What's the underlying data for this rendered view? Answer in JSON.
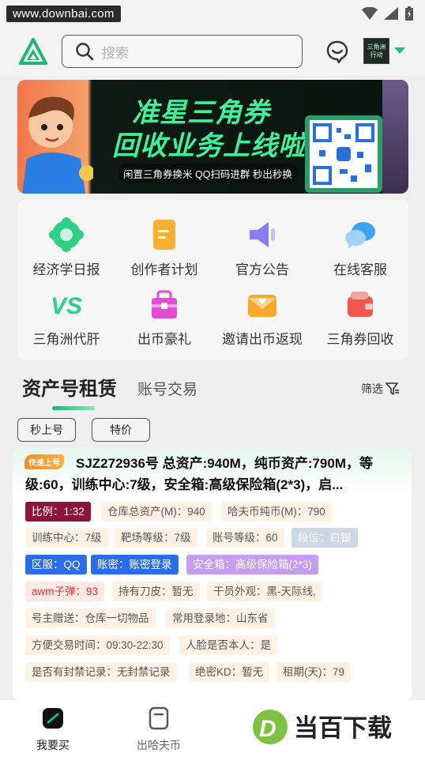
{
  "status_bar": {
    "watermark": "www.downbai.com"
  },
  "header": {
    "search_placeholder": "搜索",
    "avatar_text": "三角洲 行动"
  },
  "banner": {
    "title_line1": "准星三角券",
    "title_line2": "回收业务上线啦",
    "subtitle": "闲置三角券换米 QQ扫码进群 秒出秒换"
  },
  "menu": {
    "items": [
      {
        "label": "经济学日报",
        "icon": "flower-icon",
        "color": "#2fcf86"
      },
      {
        "label": "创作者计划",
        "icon": "document-icon",
        "color": "#f7b030"
      },
      {
        "label": "官方公告",
        "icon": "megaphone-icon",
        "color": "#8a7cf2"
      },
      {
        "label": "在线客服",
        "icon": "chat-icon",
        "color": "#3fa3f5"
      },
      {
        "label": "三角洲代肝",
        "icon": "vs-icon",
        "color": "#2fcf86"
      },
      {
        "label": "出币豪礼",
        "icon": "gift-icon",
        "color": "#e24cd0"
      },
      {
        "label": "邀请出币返现",
        "icon": "envelope-icon",
        "color": "#f7a82c"
      },
      {
        "label": "三角券回收",
        "icon": "wallet-icon",
        "color": "#f0564c"
      }
    ]
  },
  "tabs": {
    "main": "资产号租赁",
    "secondary": "账号交易",
    "filter": "筛选"
  },
  "chips": [
    "秒上号",
    "特价"
  ],
  "listing": {
    "badge": "快速上号",
    "title": "SJZ272936号 总资产:940M，纯币资产:790M，等级:60，训练中心:7级，安全箱:高级保险箱(2*3)，启...",
    "tags": [
      [
        "比例：1:32",
        "仓库总资产(M)：940",
        "哈夫币纯币(M)：790"
      ],
      [
        "训练中心：7级",
        "靶场等级：7级",
        "账号等级：60",
        "段位：白银"
      ],
      [
        "区服：QQ",
        "账密：账密登录",
        "安全箱：高级保险箱(2*3)"
      ],
      [
        "awm子弹：93",
        "持有刀皮：暂无",
        "干员外观：黑-天际线,"
      ],
      [
        "号主赠送：仓库一切物品",
        "常用登录地：山东省"
      ],
      [
        "方便交易时间：09:30-22:30",
        "人脸是否本人：是"
      ],
      [
        "是否有封禁记录：无封禁记录",
        "绝密KD：暂无",
        "租期(天)：79"
      ]
    ]
  },
  "bottom_nav": {
    "items": [
      "我要买",
      "出哈夫币"
    ],
    "watermark_logo": "当百下载"
  },
  "colors": {
    "accent": "#1db874",
    "background": "#efefef"
  }
}
